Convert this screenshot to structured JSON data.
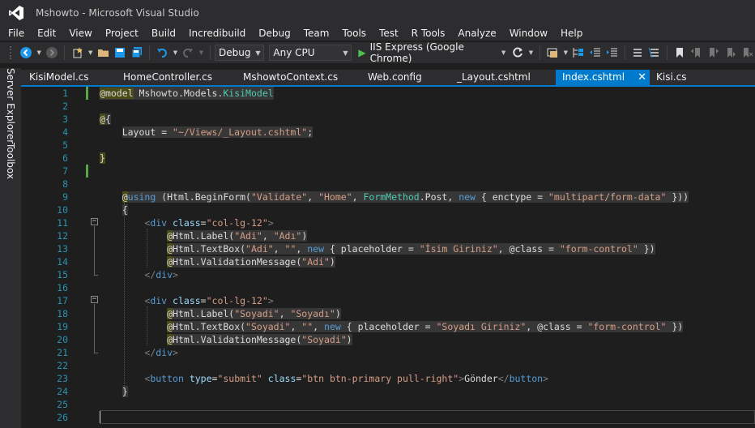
{
  "window": {
    "title": "Mshowto - Microsoft Visual Studio"
  },
  "menu": [
    "File",
    "Edit",
    "View",
    "Project",
    "Build",
    "Incredibuild",
    "Debug",
    "Team",
    "Tools",
    "Test",
    "R Tools",
    "Analyze",
    "Window",
    "Help"
  ],
  "toolbar": {
    "config": "Debug",
    "platform": "Any CPU",
    "run_label": "IIS Express (Google Chrome)"
  },
  "side_tabs": [
    "Server Explorer",
    "Toolbox"
  ],
  "tabs": [
    "KisiModel.cs",
    "HomeController.cs",
    "MshowtoContext.cs",
    "Web.config",
    "_Layout.cshtml",
    "Index.cshtml",
    "Kisi.cs"
  ],
  "active_tab": "Index.cshtml",
  "code": {
    "l1_model": "model",
    "l1_ns": "Mshowto.Models.",
    "l1_type": "KisiModel",
    "l3": "{",
    "l4_a": "Layout = ",
    "l4_str": "\"~/Views/_Layout.cshtml\"",
    "l4_b": ";",
    "l6": "}",
    "l9_using": "using",
    "l9_a": " (Html.BeginForm(",
    "l9_s1": "\"Validate\"",
    "l9_c1": ", ",
    "l9_s2": "\"Home\"",
    "l9_c2": ", ",
    "l9_fm": "FormMethod",
    "l9_b": ".Post, ",
    "l9_new": "new",
    "l9_c": " { enctype = ",
    "l9_s3": "\"multipart/form-data\"",
    "l9_d": " }))",
    "l10": "{",
    "div_tag": "div",
    "class_attr": "class",
    "class_val": "\"col-lg-12\"",
    "l12_a": "Html.Label(",
    "l12_s1": "\"Adi\"",
    "l12_c": ", ",
    "l12_s2": "\"Adı\"",
    "l12_d": ")",
    "l13_a": "Html.TextBox(",
    "l13_s1": "\"Adi\"",
    "l13_c1": ", ",
    "l13_s2": "\"\"",
    "l13_c2": ", ",
    "l13_new": "new",
    "l13_b": " { placeholder = ",
    "l13_s3": "\"İsim Giriniz\"",
    "l13_c3": ", @class = ",
    "l13_s4": "\"form-control\"",
    "l13_d": " })",
    "l14_a": "Html.ValidationMessage(",
    "l14_s": "\"Adi\"",
    "l14_d": ")",
    "l18_a": "Html.Label(",
    "l18_s1": "\"Soyadi\"",
    "l18_c": ", ",
    "l18_s2": "\"Soyadı\"",
    "l18_d": ")",
    "l19_a": "Html.TextBox(",
    "l19_s1": "\"Soyadi\"",
    "l19_c1": ", ",
    "l19_s2": "\"\"",
    "l19_c2": ", ",
    "l19_new": "new",
    "l19_b": " { placeholder = ",
    "l19_s3": "\"Soyadı Giriniz\"",
    "l19_c3": ", @class = ",
    "l19_s4": "\"form-control\"",
    "l19_d": " })",
    "l20_a": "Html.ValidationMessage(",
    "l20_s": "\"Soyadi\"",
    "l20_d": ")",
    "l23_tag": "button",
    "l23_type": "type",
    "l23_typev": "\"submit\"",
    "l23_class": "class",
    "l23_classv": "\"btn btn-primary pull-right\"",
    "l23_text": "Gönder",
    "l24": "}"
  },
  "colors": {
    "accent": "#007acc",
    "line_numbers": "#2b91af",
    "change_bar": "#57a64a"
  }
}
